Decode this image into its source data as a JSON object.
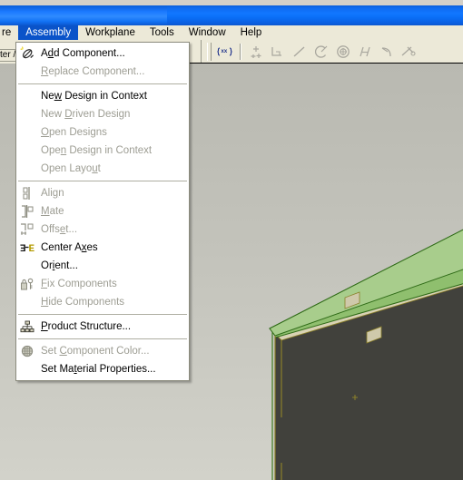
{
  "window": {
    "title": ""
  },
  "menubar": {
    "items": [
      {
        "label": "re",
        "name": "menu-feature-clipped",
        "active": false,
        "clipped": true
      },
      {
        "label": "Assembly",
        "name": "menu-assembly",
        "active": true,
        "clipped": false
      },
      {
        "label": "Workplane",
        "name": "menu-workplane",
        "active": false,
        "clipped": false
      },
      {
        "label": "Tools",
        "name": "menu-tools",
        "active": false,
        "clipped": false
      },
      {
        "label": "Window",
        "name": "menu-window",
        "active": false,
        "clipped": false
      },
      {
        "label": "Help",
        "name": "menu-help",
        "active": false,
        "clipped": false
      }
    ]
  },
  "left_panel": {
    "clipped_text": "ter /"
  },
  "toolbar": {
    "buttons": [
      {
        "name": "variables-icon",
        "title": "Variables"
      },
      {
        "name": "point-icon",
        "title": "Point"
      },
      {
        "name": "corner-icon",
        "title": "Corner"
      },
      {
        "name": "line-icon",
        "title": "Line"
      },
      {
        "name": "arc-icon",
        "title": "Arc"
      },
      {
        "name": "circle-icon",
        "title": "Circle"
      },
      {
        "name": "parallel-icon",
        "title": "Parallel"
      },
      {
        "name": "fillet-icon",
        "title": "Fillet"
      },
      {
        "name": "trim-icon",
        "title": "Trim"
      }
    ]
  },
  "dropdown": {
    "name": "assembly-menu",
    "groups": [
      {
        "items": [
          {
            "label_pre": "A",
            "label_hot": "d",
            "label_post": "d Component...",
            "disabled": false,
            "icon": "add-component-icon",
            "name": "menu-item-add-component"
          },
          {
            "label_pre": "",
            "label_hot": "R",
            "label_post": "eplace Component...",
            "disabled": true,
            "icon": "none",
            "name": "menu-item-replace-component"
          }
        ]
      },
      {
        "items": [
          {
            "label_pre": "Ne",
            "label_hot": "w",
            "label_post": " Design in Context",
            "disabled": false,
            "icon": "none",
            "name": "menu-item-new-design-in-context"
          },
          {
            "label_pre": "New ",
            "label_hot": "D",
            "label_post": "riven Design",
            "disabled": true,
            "icon": "none",
            "name": "menu-item-new-driven-design"
          },
          {
            "label_pre": "",
            "label_hot": "O",
            "label_post": "pen Designs",
            "disabled": true,
            "icon": "none",
            "name": "menu-item-open-designs"
          },
          {
            "label_pre": "Ope",
            "label_hot": "n",
            "label_post": " Design in Context",
            "disabled": true,
            "icon": "none",
            "name": "menu-item-open-design-in-context"
          },
          {
            "label_pre": "Open Layo",
            "label_hot": "u",
            "label_post": "t",
            "disabled": true,
            "icon": "none",
            "name": "menu-item-open-layout"
          }
        ]
      },
      {
        "items": [
          {
            "label_pre": "Ali",
            "label_hot": "g",
            "label_post": "n",
            "disabled": true,
            "icon": "align-icon",
            "name": "menu-item-align"
          },
          {
            "label_pre": "",
            "label_hot": "M",
            "label_post": "ate",
            "disabled": true,
            "icon": "mate-icon",
            "name": "menu-item-mate"
          },
          {
            "label_pre": "Offs",
            "label_hot": "e",
            "label_post": "t...",
            "disabled": true,
            "icon": "offset-icon",
            "name": "menu-item-offset"
          },
          {
            "label_pre": "Center A",
            "label_hot": "x",
            "label_post": "es",
            "disabled": false,
            "icon": "center-axes-icon",
            "name": "menu-item-center-axes"
          },
          {
            "label_pre": "Or",
            "label_hot": "i",
            "label_post": "ent...",
            "disabled": false,
            "icon": "none",
            "name": "menu-item-orient"
          },
          {
            "label_pre": "",
            "label_hot": "F",
            "label_post": "ix Components",
            "disabled": true,
            "icon": "fix-components-icon",
            "name": "menu-item-fix-components"
          },
          {
            "label_pre": "",
            "label_hot": "H",
            "label_post": "ide Components",
            "disabled": true,
            "icon": "none",
            "name": "menu-item-hide-components"
          }
        ]
      },
      {
        "items": [
          {
            "label_pre": "",
            "label_hot": "P",
            "label_post": "roduct Structure...",
            "disabled": false,
            "icon": "product-structure-icon",
            "name": "menu-item-product-structure"
          }
        ]
      },
      {
        "items": [
          {
            "label_pre": "Set ",
            "label_hot": "C",
            "label_post": "omponent Color...",
            "disabled": true,
            "icon": "set-component-color-icon",
            "name": "menu-item-set-component-color"
          },
          {
            "label_pre": "Set Ma",
            "label_hot": "t",
            "label_post": "erial Properties...",
            "disabled": false,
            "icon": "none",
            "name": "menu-item-set-material-properties"
          }
        ]
      }
    ]
  },
  "viewport": {
    "name": "3d-viewport",
    "model_name": "green-sheet-metal-box",
    "colors": {
      "background_top": "#b9b9b1",
      "background_bottom": "#d2d2ca",
      "model_top_face": "#8fbf6e",
      "model_side_face": "#7cae5c",
      "model_edge": "#3f7a1f",
      "model_interior": "#41413c",
      "model_tab": "#d8d2b4",
      "highlight_edge": "#ff0000",
      "accent": "#0a53c9"
    }
  }
}
